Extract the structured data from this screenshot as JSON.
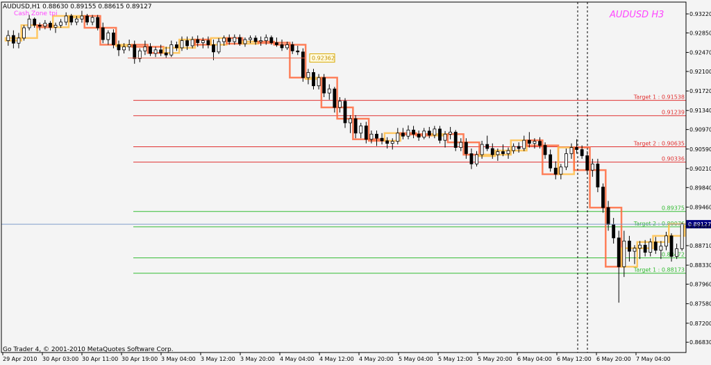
{
  "header": {
    "symbol_line": "AUDUSD,H1  0.88630 0.89155 0.88615 0.89127",
    "indicator_label": "Cash Zone tpi",
    "big_title": "AUDUSD   H3"
  },
  "footer": {
    "copyright": "Go Trader 4, © 2001-2010 MetaQuotes Software Corp."
  },
  "current_price": {
    "label": "0.89127",
    "value": 0.89127,
    "color": "#7f9cc9"
  },
  "colors": {
    "up_candle": "#6b4b2a",
    "htf_body_dark": "#ff6a3d",
    "htf_body_light": "#ffc04a",
    "resistance": "#e03030",
    "support": "#33bb33",
    "axis": "#000000",
    "grid_text": "#000000",
    "title_pink": "#ff44ff"
  },
  "chart_data": {
    "type": "candlestick",
    "timeframe": "H1",
    "yaxis_ticks": [
      "0.93220",
      "0.92850",
      "0.92470",
      "0.92100",
      "0.91720",
      "0.91340",
      "0.90970",
      "0.90590",
      "0.90210",
      "0.89840",
      "0.89460",
      "0.89090",
      "0.88710",
      "0.88330",
      "0.87960",
      "0.87580",
      "0.87200",
      "0.86830"
    ],
    "ylim": [
      0.8663,
      0.9345
    ],
    "xaxis_ticks": [
      "29 Apr 2010",
      "30 Apr 03:00",
      "30 Apr 11:00",
      "30 Apr 19:00",
      "3 May 04:00",
      "3 May 12:00",
      "3 May 20:00",
      "4 May 04:00",
      "4 May 12:00",
      "4 May 20:00",
      "5 May 04:00",
      "5 May 12:00",
      "5 May 20:00",
      "6 May 04:00",
      "6 May 12:00",
      "6 May 20:00",
      "7 May 04:00"
    ],
    "price_label_box": {
      "text": "0.92362",
      "value": 0.92362
    },
    "levels": [
      {
        "label": "Target 1 : 0.91538",
        "value": 0.91538,
        "kind": "resistance"
      },
      {
        "label": "0.91239",
        "value": 0.91239,
        "kind": "resistance"
      },
      {
        "label": "Target 2 : 0.90635",
        "value": 0.90635,
        "kind": "resistance"
      },
      {
        "label": "0.90336",
        "value": 0.90336,
        "kind": "resistance"
      },
      {
        "label": "0.89375",
        "value": 0.89375,
        "kind": "support"
      },
      {
        "label": "Target 2 : 0.89076",
        "value": 0.89076,
        "kind": "support"
      },
      {
        "label": "0.88472",
        "value": 0.88472,
        "kind": "support"
      },
      {
        "label": "Target 1 : 0.88173",
        "value": 0.88173,
        "kind": "support"
      }
    ],
    "candles": [
      [
        0.927,
        0.929,
        0.926,
        0.928
      ],
      [
        0.928,
        0.929,
        0.9255,
        0.9265
      ],
      [
        0.9265,
        0.9285,
        0.9255,
        0.9275
      ],
      [
        0.9275,
        0.93,
        0.927,
        0.9295
      ],
      [
        0.9295,
        0.932,
        0.929,
        0.9312
      ],
      [
        0.9312,
        0.9315,
        0.9295,
        0.93
      ],
      [
        0.93,
        0.9305,
        0.929,
        0.9298
      ],
      [
        0.9298,
        0.931,
        0.9292,
        0.9304
      ],
      [
        0.9304,
        0.9308,
        0.929,
        0.9296
      ],
      [
        0.9296,
        0.9305,
        0.9285,
        0.93
      ],
      [
        0.93,
        0.9312,
        0.9295,
        0.9306
      ],
      [
        0.9306,
        0.9325,
        0.93,
        0.9318
      ],
      [
        0.9318,
        0.9322,
        0.93,
        0.9306
      ],
      [
        0.9306,
        0.9318,
        0.93,
        0.9312
      ],
      [
        0.9312,
        0.9328,
        0.9305,
        0.9318
      ],
      [
        0.9318,
        0.9322,
        0.93,
        0.9306
      ],
      [
        0.9306,
        0.932,
        0.93,
        0.9315
      ],
      [
        0.9315,
        0.932,
        0.929,
        0.9295
      ],
      [
        0.9295,
        0.9305,
        0.9265,
        0.9272
      ],
      [
        0.9272,
        0.929,
        0.9262,
        0.9285
      ],
      [
        0.9285,
        0.9292,
        0.9255,
        0.9262
      ],
      [
        0.9262,
        0.927,
        0.924,
        0.9252
      ],
      [
        0.9252,
        0.9265,
        0.9245,
        0.9258
      ],
      [
        0.9258,
        0.9272,
        0.925,
        0.9262
      ],
      [
        0.9262,
        0.927,
        0.9225,
        0.9235
      ],
      [
        0.9235,
        0.9255,
        0.9228,
        0.925
      ],
      [
        0.925,
        0.927,
        0.9242,
        0.9258
      ],
      [
        0.9258,
        0.9265,
        0.924,
        0.9245
      ],
      [
        0.9245,
        0.9258,
        0.9238,
        0.9252
      ],
      [
        0.9252,
        0.9262,
        0.924,
        0.9246
      ],
      [
        0.9246,
        0.9258,
        0.9236,
        0.9242
      ],
      [
        0.9242,
        0.927,
        0.9238,
        0.9262
      ],
      [
        0.9262,
        0.9268,
        0.925,
        0.9256
      ],
      [
        0.9256,
        0.9278,
        0.925,
        0.927
      ],
      [
        0.927,
        0.9278,
        0.9252,
        0.926
      ],
      [
        0.926,
        0.9278,
        0.9255,
        0.9272
      ],
      [
        0.9272,
        0.928,
        0.9258,
        0.9266
      ],
      [
        0.9266,
        0.9276,
        0.9255,
        0.927
      ],
      [
        0.927,
        0.9278,
        0.9255,
        0.9262
      ],
      [
        0.9262,
        0.9272,
        0.9232,
        0.9248
      ],
      [
        0.9248,
        0.9275,
        0.9244,
        0.9268
      ],
      [
        0.9268,
        0.928,
        0.926,
        0.9275
      ],
      [
        0.9275,
        0.9282,
        0.9262,
        0.9268
      ],
      [
        0.9268,
        0.9282,
        0.9262,
        0.9276
      ],
      [
        0.9276,
        0.9282,
        0.926,
        0.9264
      ],
      [
        0.9264,
        0.9276,
        0.9258,
        0.9272
      ],
      [
        0.9272,
        0.928,
        0.9265,
        0.9275
      ],
      [
        0.9275,
        0.928,
        0.9262,
        0.9268
      ],
      [
        0.9268,
        0.9278,
        0.926,
        0.927
      ],
      [
        0.927,
        0.9282,
        0.9262,
        0.9276
      ],
      [
        0.9276,
        0.928,
        0.9262,
        0.9266
      ],
      [
        0.9266,
        0.9276,
        0.9258,
        0.9262
      ],
      [
        0.9262,
        0.9272,
        0.925,
        0.9256
      ],
      [
        0.9256,
        0.9268,
        0.9252,
        0.9262
      ],
      [
        0.9262,
        0.9268,
        0.9244,
        0.925
      ],
      [
        0.925,
        0.926,
        0.9242,
        0.9248
      ],
      [
        0.9248,
        0.9255,
        0.919,
        0.9198
      ],
      [
        0.9198,
        0.9215,
        0.9185,
        0.9208
      ],
      [
        0.9208,
        0.9215,
        0.9175,
        0.9182
      ],
      [
        0.9182,
        0.9205,
        0.9175,
        0.9198
      ],
      [
        0.9198,
        0.9205,
        0.916,
        0.9168
      ],
      [
        0.9168,
        0.9185,
        0.9155,
        0.9176
      ],
      [
        0.9176,
        0.918,
        0.913,
        0.914
      ],
      [
        0.914,
        0.916,
        0.913,
        0.9152
      ],
      [
        0.9152,
        0.9158,
        0.91,
        0.911
      ],
      [
        0.911,
        0.9125,
        0.909,
        0.9118
      ],
      [
        0.9118,
        0.9125,
        0.908,
        0.909
      ],
      [
        0.909,
        0.911,
        0.908,
        0.9104
      ],
      [
        0.9104,
        0.9112,
        0.907,
        0.9078
      ],
      [
        0.9078,
        0.9095,
        0.907,
        0.9088
      ],
      [
        0.9088,
        0.9095,
        0.9065,
        0.908
      ],
      [
        0.908,
        0.909,
        0.9068,
        0.9075
      ],
      [
        0.9075,
        0.9082,
        0.906,
        0.907
      ],
      [
        0.907,
        0.908,
        0.9058,
        0.9074
      ],
      [
        0.9074,
        0.91,
        0.9068,
        0.909
      ],
      [
        0.909,
        0.91,
        0.9078,
        0.9084
      ],
      [
        0.9084,
        0.9105,
        0.9078,
        0.9096
      ],
      [
        0.9096,
        0.9104,
        0.908,
        0.9088
      ],
      [
        0.9088,
        0.9095,
        0.9075,
        0.9082
      ],
      [
        0.9082,
        0.91,
        0.9078,
        0.9094
      ],
      [
        0.9094,
        0.9102,
        0.908,
        0.9086
      ],
      [
        0.9086,
        0.9104,
        0.908,
        0.9098
      ],
      [
        0.9098,
        0.9104,
        0.907,
        0.9076
      ],
      [
        0.9076,
        0.9094,
        0.9062,
        0.9088
      ],
      [
        0.9088,
        0.9102,
        0.9078,
        0.9092
      ],
      [
        0.9092,
        0.9096,
        0.9055,
        0.9062
      ],
      [
        0.9062,
        0.908,
        0.9055,
        0.9072
      ],
      [
        0.9072,
        0.908,
        0.904,
        0.905
      ],
      [
        0.905,
        0.906,
        0.902,
        0.903
      ],
      [
        0.903,
        0.9055,
        0.9025,
        0.9048
      ],
      [
        0.9048,
        0.9075,
        0.904,
        0.9068
      ],
      [
        0.9068,
        0.9085,
        0.9055,
        0.906
      ],
      [
        0.906,
        0.907,
        0.904,
        0.9048
      ],
      [
        0.9048,
        0.906,
        0.9036,
        0.9054
      ],
      [
        0.9054,
        0.9068,
        0.9045,
        0.905
      ],
      [
        0.905,
        0.9062,
        0.904,
        0.9056
      ],
      [
        0.9056,
        0.907,
        0.905,
        0.9064
      ],
      [
        0.9064,
        0.9072,
        0.9052,
        0.906
      ],
      [
        0.906,
        0.9085,
        0.9055,
        0.9076
      ],
      [
        0.9076,
        0.9092,
        0.9062,
        0.907
      ],
      [
        0.907,
        0.908,
        0.906,
        0.9074
      ],
      [
        0.9074,
        0.9082,
        0.906,
        0.9066
      ],
      [
        0.9066,
        0.9072,
        0.904,
        0.9048
      ],
      [
        0.9048,
        0.9058,
        0.9015,
        0.9022
      ],
      [
        0.9022,
        0.9035,
        0.9,
        0.901
      ],
      [
        0.901,
        0.903,
        0.9,
        0.9024
      ],
      [
        0.9024,
        0.906,
        0.9018,
        0.905
      ],
      [
        0.905,
        0.907,
        0.904,
        0.9062
      ],
      [
        0.9062,
        0.9078,
        0.905,
        0.9058
      ],
      [
        0.9058,
        0.9066,
        0.904,
        0.9046
      ],
      [
        0.9046,
        0.9055,
        0.901,
        0.9018
      ],
      [
        0.9018,
        0.904,
        0.9005,
        0.903
      ],
      [
        0.903,
        0.904,
        0.8975,
        0.8985
      ],
      [
        0.8985,
        0.8992,
        0.8935,
        0.8945
      ],
      [
        0.8945,
        0.8958,
        0.89,
        0.8912
      ],
      [
        0.8912,
        0.8925,
        0.8875,
        0.8886
      ],
      [
        0.8886,
        0.89,
        0.876,
        0.883
      ],
      [
        0.883,
        0.89,
        0.881,
        0.888
      ],
      [
        0.888,
        0.889,
        0.884,
        0.886
      ],
      [
        0.886,
        0.8872,
        0.8835,
        0.8866
      ],
      [
        0.8866,
        0.888,
        0.8845,
        0.8872
      ],
      [
        0.8872,
        0.8882,
        0.885,
        0.8858
      ],
      [
        0.8858,
        0.8885,
        0.885,
        0.8878
      ],
      [
        0.8878,
        0.8888,
        0.8855,
        0.8862
      ],
      [
        0.8862,
        0.888,
        0.8845,
        0.887
      ],
      [
        0.887,
        0.8898,
        0.8862,
        0.889
      ],
      [
        0.889,
        0.8895,
        0.884,
        0.885
      ],
      [
        0.885,
        0.8875,
        0.8845,
        0.8865
      ],
      [
        0.8865,
        0.8916,
        0.8861,
        0.8913
      ]
    ]
  }
}
